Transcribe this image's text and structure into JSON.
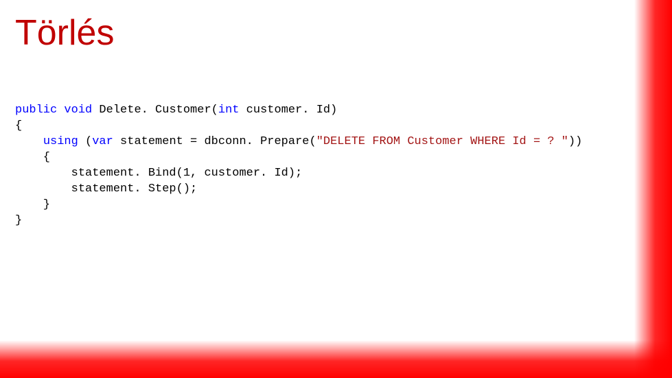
{
  "slide": {
    "title": "Törlés"
  },
  "code": {
    "kw_public": "public",
    "kw_void": "void",
    "method_name": " Delete. Customer(",
    "kw_int": "int",
    "param_name": " customer. Id)",
    "brace_open1": "{",
    "indent1": "    ",
    "kw_using": "using",
    "using_open": " (",
    "kw_var": "var",
    "stmt_assign": " statement = dbconn. Prepare(",
    "sql_string": "\"DELETE FROM Customer WHERE Id = ? \"",
    "using_close": "))",
    "brace_open2": "    {",
    "line_bind": "        statement. Bind(1, customer. Id);",
    "line_step": "        statement. Step();",
    "brace_close2": "    }",
    "brace_close1": "}"
  }
}
